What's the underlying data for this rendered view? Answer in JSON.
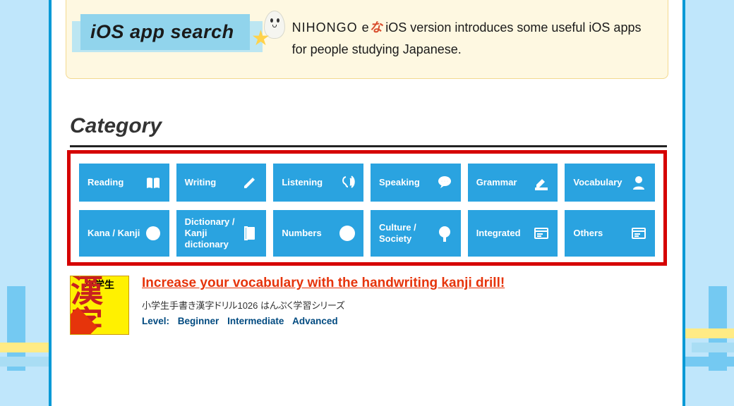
{
  "header": {
    "title": "iOS app search",
    "desc_prefix": "NIHONGO e",
    "desc_na": "な",
    "desc_rest": " iOS version introduces some useful iOS apps for people studying Japanese."
  },
  "sections": {
    "category_heading": "Category"
  },
  "categories_row1": [
    {
      "label": "Reading",
      "icon": "book"
    },
    {
      "label": "Writing",
      "icon": "pencil"
    },
    {
      "label": "Listening",
      "icon": "ear"
    },
    {
      "label": "Speaking",
      "icon": "speech"
    },
    {
      "label": "Grammar",
      "icon": "highlighter"
    },
    {
      "label": "Vocabulary",
      "icon": "head"
    }
  ],
  "categories_row2": [
    {
      "label": "Kana / Kanji",
      "icon": "a-circle"
    },
    {
      "label": "Dictionary / Kanji dictionary",
      "icon": "dict"
    },
    {
      "label": "Numbers",
      "icon": "123"
    },
    {
      "label": "Culture / Society",
      "icon": "fan"
    },
    {
      "label": "Integrated",
      "icon": "window"
    },
    {
      "label": "Others",
      "icon": "window2"
    }
  ],
  "article": {
    "thumb_top": "小学生",
    "thumb_main": "漢字",
    "title": "Increase your vocabulary with the handwriting kanji drill!",
    "subtitle": "小学生手書き漢字ドリル1026 はんぷく学習シリーズ",
    "levels_label": "Level:",
    "levels": [
      "Beginner",
      "Intermediate",
      "Advanced"
    ]
  }
}
